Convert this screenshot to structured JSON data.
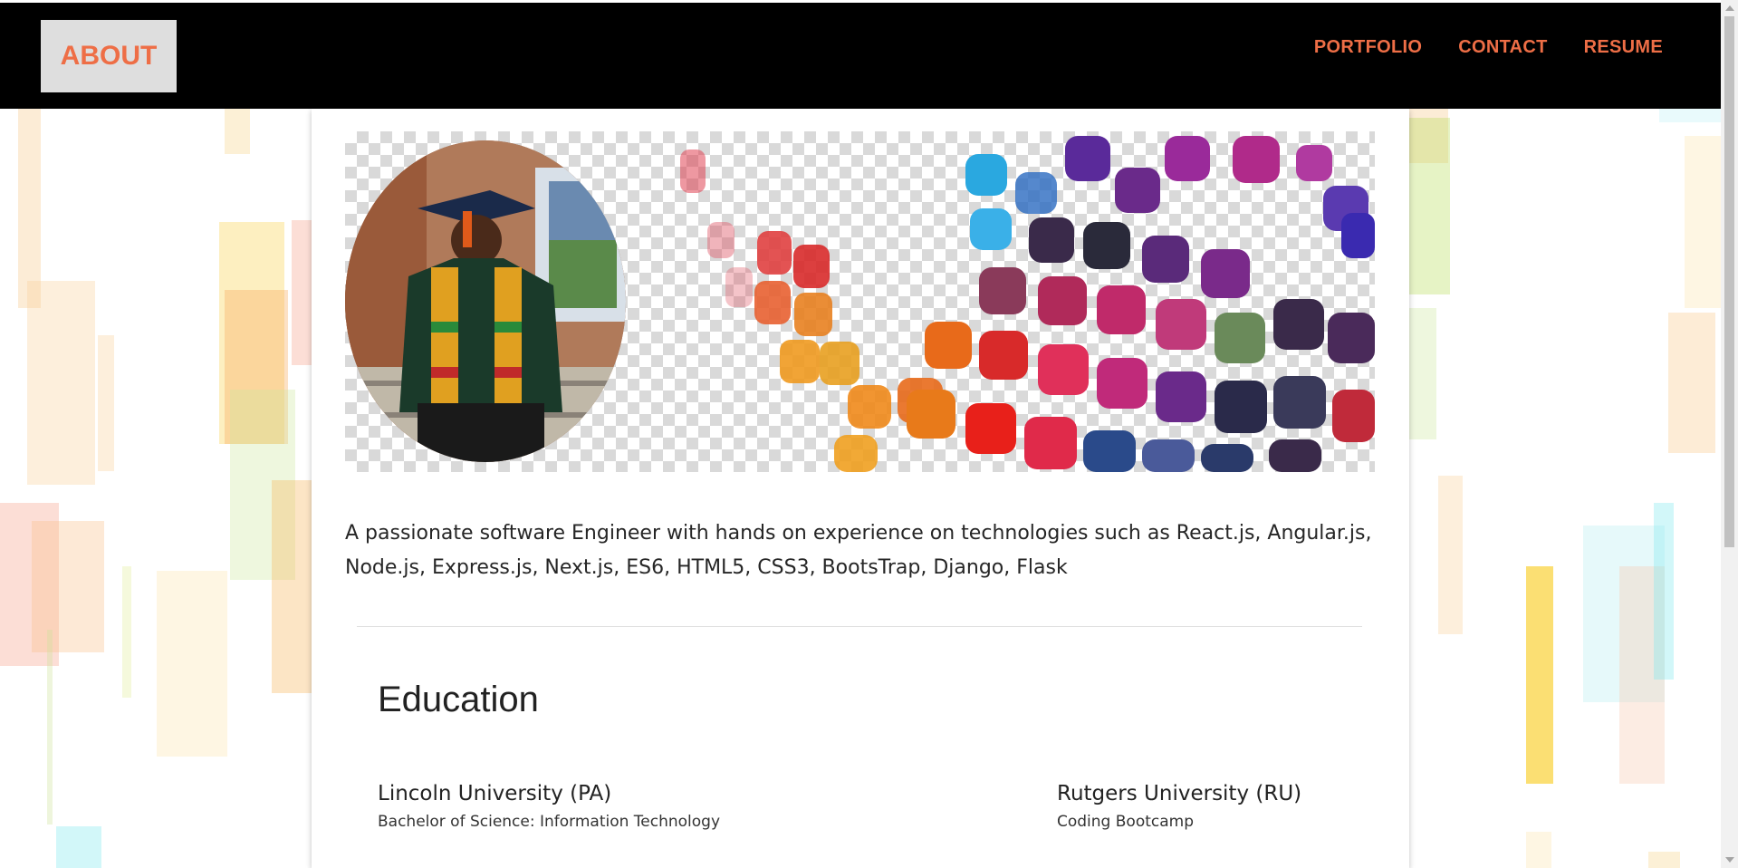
{
  "nav": {
    "home_label": "ABOUT",
    "links": [
      "PORTFOLIO",
      "CONTACT",
      "RESUME"
    ]
  },
  "colors": {
    "accent": "#ee6e46",
    "navbar_bg": "#000000",
    "home_button_bg": "#dedede"
  },
  "intro_text": "A passionate software Engineer with hands on experience on technologies such as React.js, Angular.js, Node.js, Express.js, Next.js, ES6, HTML5, CSS3, BootsTrap, Django, Flask",
  "education": {
    "title": "Education",
    "schools": [
      {
        "name": "Lincoln University (PA)",
        "degree": "Bachelor of Science: Information Technology"
      },
      {
        "name": "Rutgers University (RU)",
        "degree": "Coding Bootcamp"
      }
    ]
  },
  "icons": {
    "banner": "abstract-colorful-tiles-image",
    "profile": "graduation-portrait-photo"
  }
}
